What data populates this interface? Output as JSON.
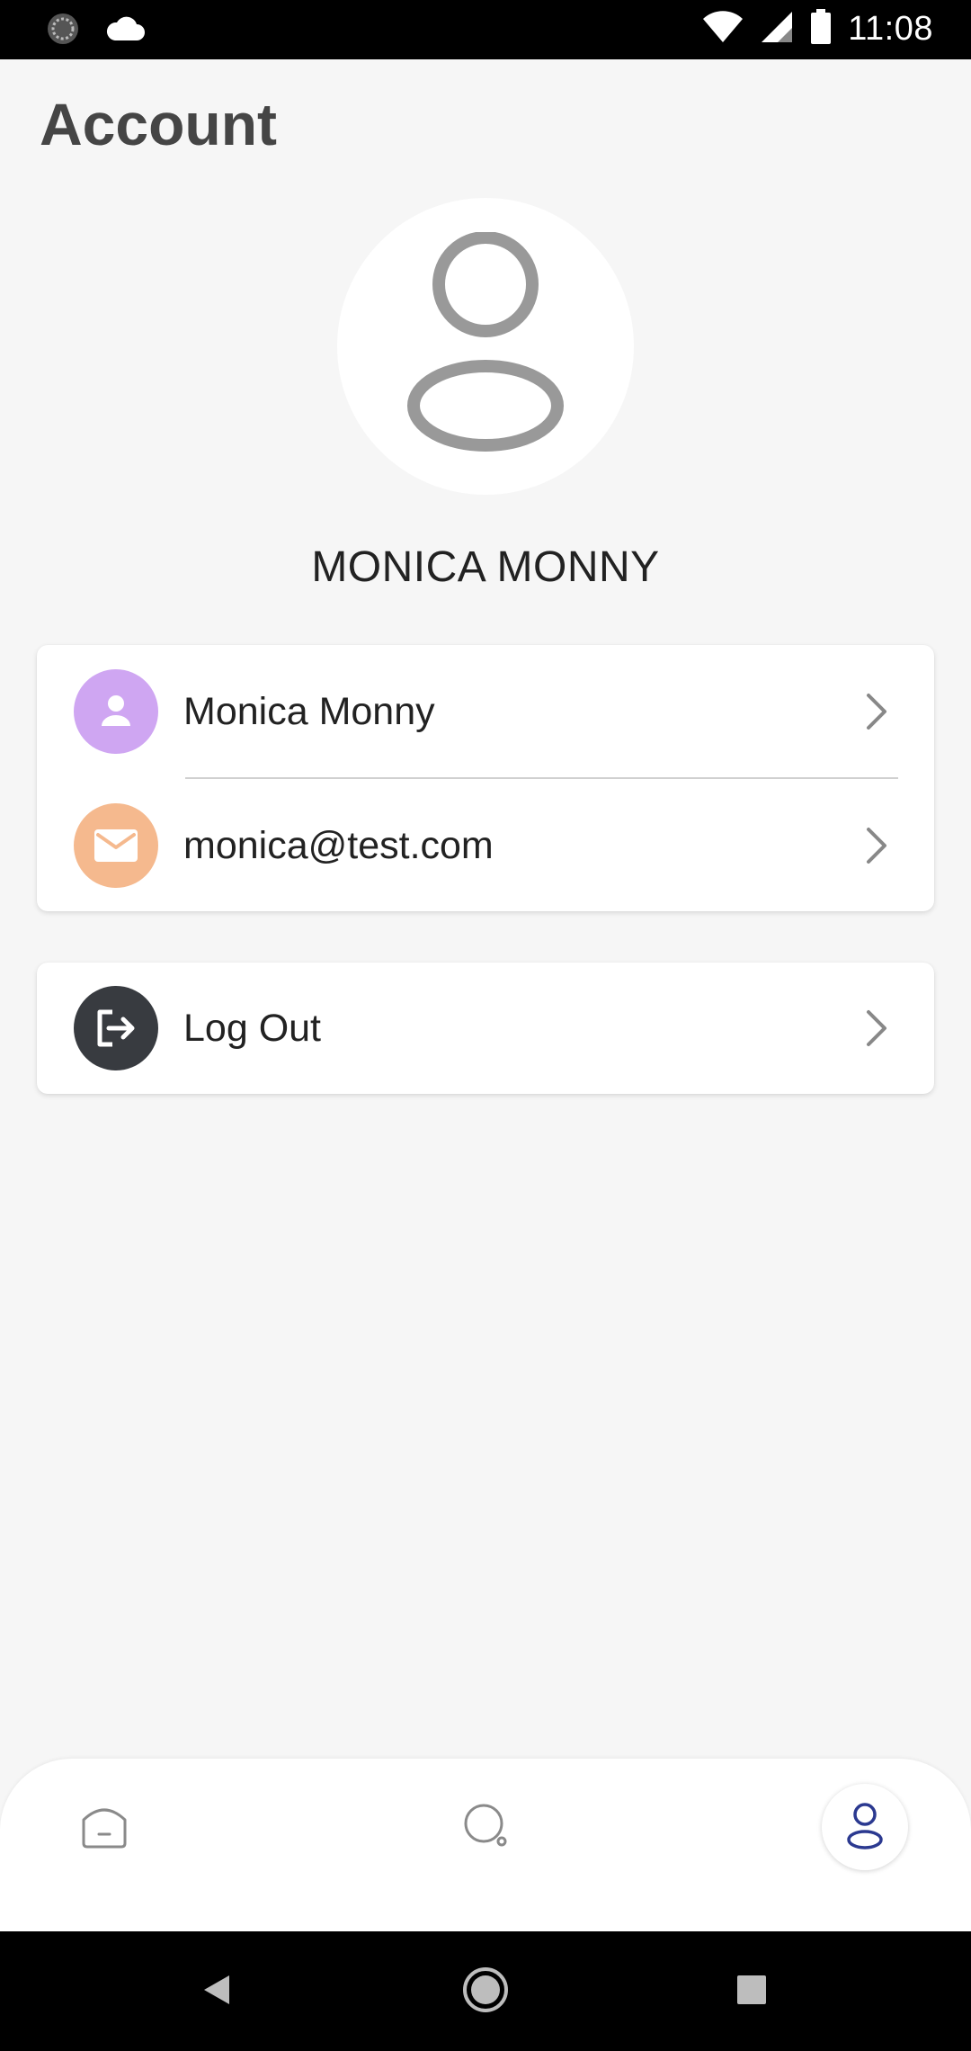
{
  "status_bar": {
    "time": "11:08",
    "left_icons": [
      "sync-icon",
      "cloud-icon"
    ],
    "right_icons": [
      "wifi-icon",
      "cell-signal-icon",
      "battery-icon"
    ]
  },
  "page": {
    "title": "Account"
  },
  "profile": {
    "avatar_icon": "user-outline-icon",
    "display_name": "MONICA MONNY"
  },
  "info_card": {
    "items": [
      {
        "label": "Monica Monny",
        "icon": "person-icon",
        "icon_bg": "#cfa6f2"
      },
      {
        "label": "monica@test.com",
        "icon": "mail-icon",
        "icon_bg": "#f5b98e"
      }
    ]
  },
  "logout_card": {
    "label": "Log Out",
    "icon": "logout-icon",
    "icon_bg": "#383b40"
  },
  "bottom_nav": {
    "items": [
      {
        "name": "home",
        "icon": "home-icon",
        "active": false
      },
      {
        "name": "search",
        "icon": "search-icon",
        "active": false
      },
      {
        "name": "account",
        "icon": "user-icon",
        "active": true
      }
    ],
    "active_color": "#2b3990"
  },
  "system_nav": {
    "buttons": [
      "back-icon",
      "home-circle-icon",
      "recents-icon"
    ]
  }
}
